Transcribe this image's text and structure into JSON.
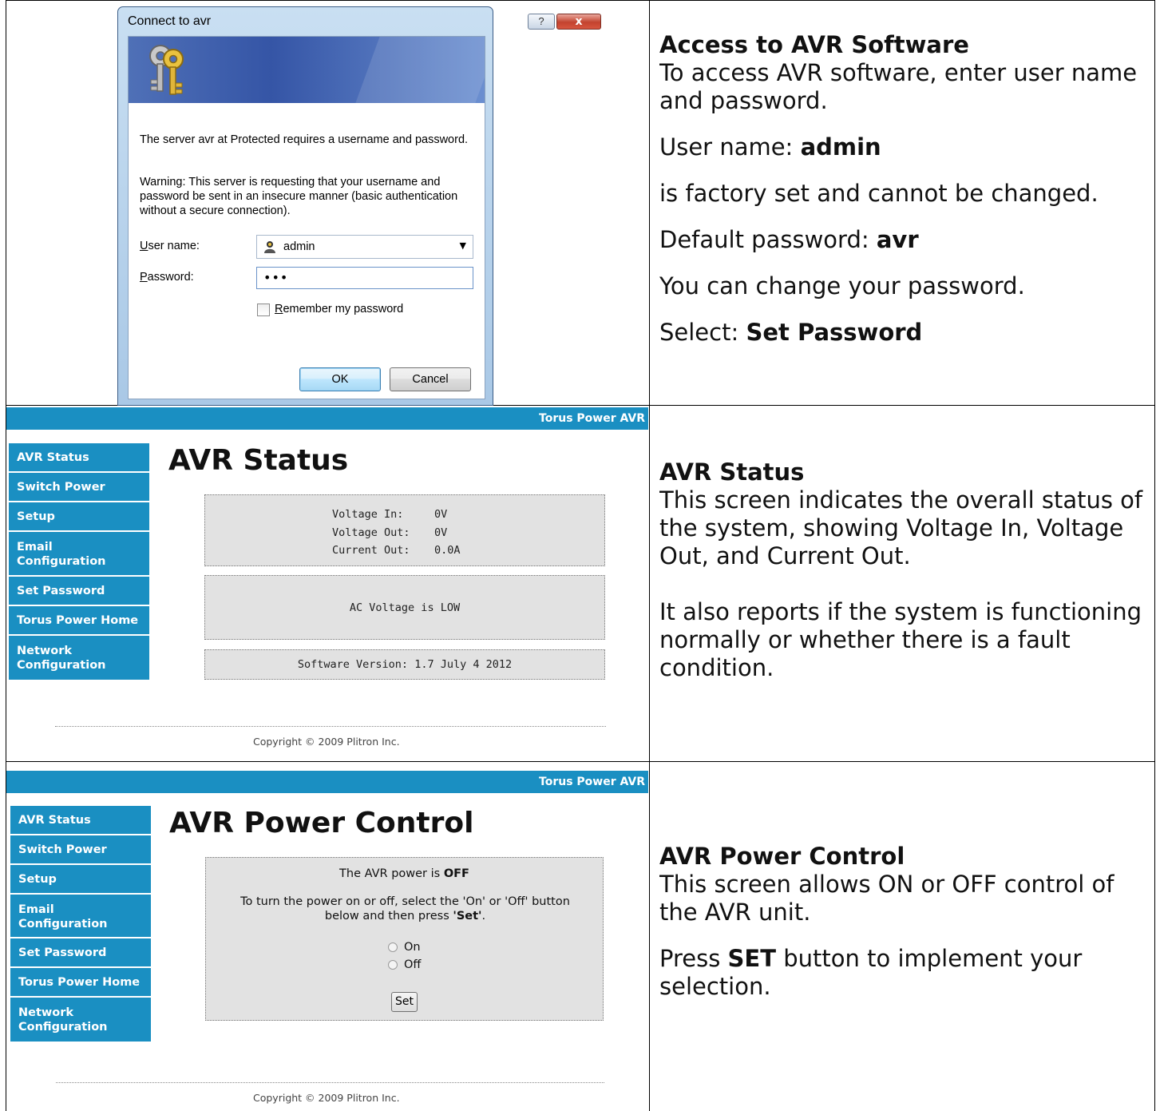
{
  "dialog": {
    "title": "Connect to avr",
    "help_label": "?",
    "close_label": "x",
    "message": "The server avr at Protected requires a username and password.",
    "warning": "Warning: This server is requesting that your username and password be sent in an insecure manner (basic authentication without a secure connection).",
    "username_label": "User name:",
    "username_value": "admin",
    "password_label": "Password:",
    "password_value": "•••",
    "remember_label": "Remember my password",
    "ok_label": "OK",
    "cancel_label": "Cancel"
  },
  "access_doc": {
    "heading": "Access to AVR Software",
    "intro": "To access AVR software, enter user name and password.",
    "user_prefix": "User name: ",
    "user_value": "admin",
    "factory_note": "is factory set and cannot be changed.",
    "pw_prefix": "Default password: ",
    "pw_value": "avr",
    "change_note": "You can change your password.",
    "select_prefix": "Select: ",
    "select_value": "Set Password"
  },
  "brand": "Torus Power AVR",
  "nav": {
    "avr_status": "AVR Status",
    "switch_power": "Switch Power",
    "setup": "Setup",
    "email_line1": "Email",
    "email_line2": "Configuration",
    "set_password": "Set Password",
    "torus_home": "Torus Power Home",
    "network_line1": "Network",
    "network_line2": "Configuration"
  },
  "status_page": {
    "title": "AVR Status",
    "voltage_in_label": "Voltage In:",
    "voltage_in_value": "0V",
    "voltage_out_label": "Voltage Out:",
    "voltage_out_value": "0V",
    "current_out_label": "Current Out:",
    "current_out_value": "0.0A",
    "alert": "AC Voltage is LOW",
    "software_version": "Software Version: 1.7 July 4 2012",
    "copyright": "Copyright © 2009 Plitron Inc."
  },
  "status_doc": {
    "heading": "AVR Status",
    "para1": "This screen indicates the overall status of the system, showing Voltage In, Voltage Out, and Current Out.",
    "para2": "It also reports if the system is functioning normally or whether there is a fault condition."
  },
  "power_page": {
    "title": "AVR Power Control",
    "state_prefix": "The AVR power is ",
    "state_value": "OFF",
    "instr_a": "To turn the power on or off, select the 'On' or 'Off' button below and then press ",
    "instr_set": "'Set'",
    "instr_end": ".",
    "opt_on": "On",
    "opt_off": "Off",
    "set_label": "Set",
    "copyright": "Copyright © 2009 Plitron Inc."
  },
  "power_doc": {
    "heading": "AVR Power Control",
    "para1": "This screen allows ON or OFF control of the AVR unit.",
    "para2_prefix": "Press ",
    "para2_bold": "SET",
    "para2_rest": " button to implement your selection."
  },
  "colors": {
    "accent": "#1a8fc2",
    "panel_gray": "#e2e2e2"
  }
}
